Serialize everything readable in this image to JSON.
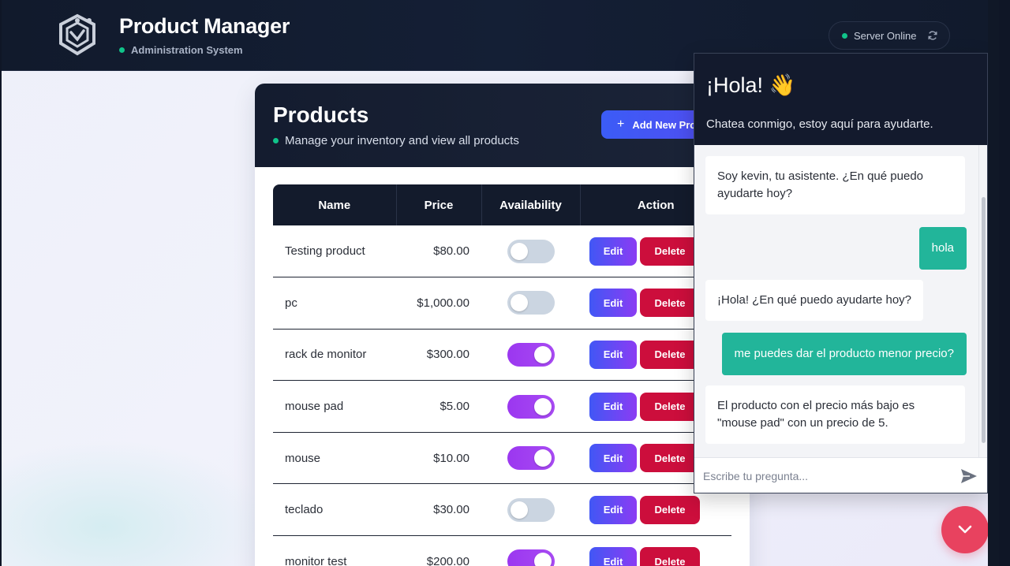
{
  "header": {
    "title": "Product Manager",
    "subtitle": "Administration System",
    "server_status": "Server Online"
  },
  "products": {
    "title": "Products",
    "subtitle": "Manage your inventory and view all products",
    "add_button": "Add New Product",
    "columns": [
      "Name",
      "Price",
      "Availability",
      "Action"
    ],
    "edit_label": "Edit",
    "delete_label": "Delete",
    "rows": [
      {
        "name": "Testing product",
        "price": "$80.00",
        "available": false
      },
      {
        "name": "pc",
        "price": "$1,000.00",
        "available": false
      },
      {
        "name": "rack de monitor",
        "price": "$300.00",
        "available": true
      },
      {
        "name": "mouse pad",
        "price": "$5.00",
        "available": true
      },
      {
        "name": "mouse",
        "price": "$10.00",
        "available": true
      },
      {
        "name": "teclado",
        "price": "$30.00",
        "available": false
      },
      {
        "name": "monitor test",
        "price": "$200.00",
        "available": true
      }
    ]
  },
  "chat": {
    "title": "¡Hola! 👋",
    "subtitle": "Chatea conmigo, estoy aquí para ayudarte.",
    "messages": [
      {
        "from": "bot",
        "text": "Soy kevin, tu asistente. ¿En qué puedo ayudarte hoy?"
      },
      {
        "from": "user",
        "text": "hola"
      },
      {
        "from": "bot",
        "text": "¡Hola! ¿En qué puedo ayudarte hoy?"
      },
      {
        "from": "user",
        "text": "me puedes dar el producto menor precio?"
      },
      {
        "from": "bot",
        "text": "El producto con el precio más bajo es \"mouse pad\" con un precio de 5."
      }
    ],
    "input_placeholder": "Escribe tu pregunta...",
    "input_value": ""
  },
  "colors": {
    "accent": "#3b5cf6",
    "toggle_on": "#a043f2",
    "delete": "#cc0e3c",
    "chat_user_bubble": "#22b59a",
    "fab": "#e8425f",
    "status_online": "#10c48a"
  },
  "icons": {
    "logo": "shield-logo-icon",
    "refresh": "refresh-icon",
    "plus": "plus-icon",
    "send": "send-icon",
    "fab": "chevron-down-icon"
  }
}
